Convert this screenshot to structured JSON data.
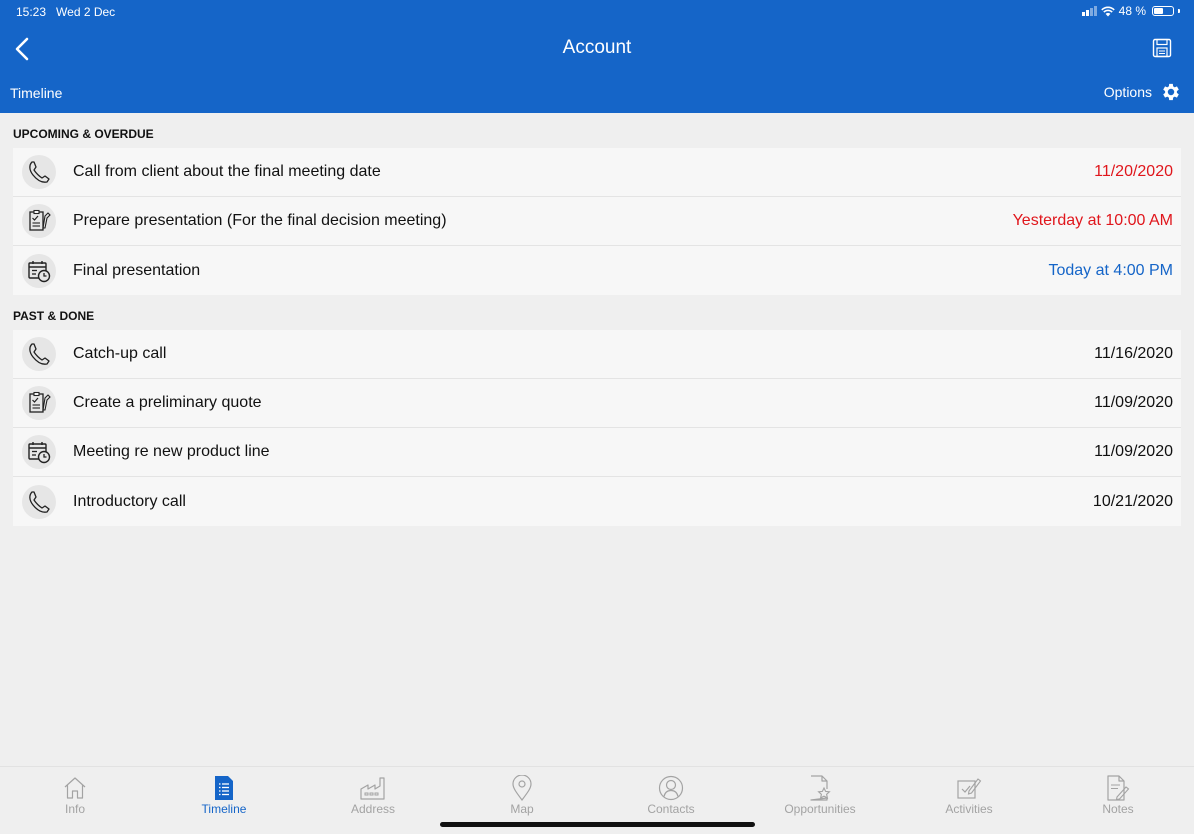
{
  "status": {
    "time": "15:23",
    "date": "Wed 2 Dec",
    "battery": "48 %",
    "battery_level": 0.48
  },
  "header": {
    "title": "Account",
    "subtitle": "Timeline",
    "options_label": "Options"
  },
  "sections": [
    {
      "title": "UPCOMING & OVERDUE",
      "items": [
        {
          "icon": "phone-icon",
          "label": "Call from client about the final meeting date",
          "date": "11/20/2020",
          "status": "overdue"
        },
        {
          "icon": "task-icon",
          "label": "Prepare presentation (For the final decision meeting)",
          "date": "Yesterday at 10:00 AM",
          "status": "overdue"
        },
        {
          "icon": "meeting-icon",
          "label": "Final presentation",
          "date": "Today at 4:00 PM",
          "status": "upcoming"
        }
      ]
    },
    {
      "title": "PAST & DONE",
      "items": [
        {
          "icon": "phone-icon",
          "label": "Catch-up call",
          "date": "11/16/2020",
          "status": "past"
        },
        {
          "icon": "task-icon",
          "label": "Create a preliminary quote",
          "date": "11/09/2020",
          "status": "past"
        },
        {
          "icon": "meeting-icon",
          "label": "Meeting re new product line",
          "date": "11/09/2020",
          "status": "past"
        },
        {
          "icon": "phone-icon",
          "label": "Introductory call",
          "date": "10/21/2020",
          "status": "past"
        }
      ]
    }
  ],
  "tabs": [
    {
      "label": "Info",
      "icon": "home-icon",
      "active": false
    },
    {
      "label": "Timeline",
      "icon": "timeline-icon",
      "active": true
    },
    {
      "label": "Address",
      "icon": "factory-icon",
      "active": false
    },
    {
      "label": "Map",
      "icon": "map-pin-icon",
      "active": false
    },
    {
      "label": "Contacts",
      "icon": "person-icon",
      "active": false
    },
    {
      "label": "Opportunities",
      "icon": "document-star-icon",
      "active": false
    },
    {
      "label": "Activities",
      "icon": "checkbox-edit-icon",
      "active": false
    },
    {
      "label": "Notes",
      "icon": "notes-icon",
      "active": false
    }
  ],
  "colors": {
    "brand": "#1565c8",
    "overdue": "#e0161c",
    "upcoming": "#1565c8",
    "inactive_tab": "#a3a3a3"
  }
}
